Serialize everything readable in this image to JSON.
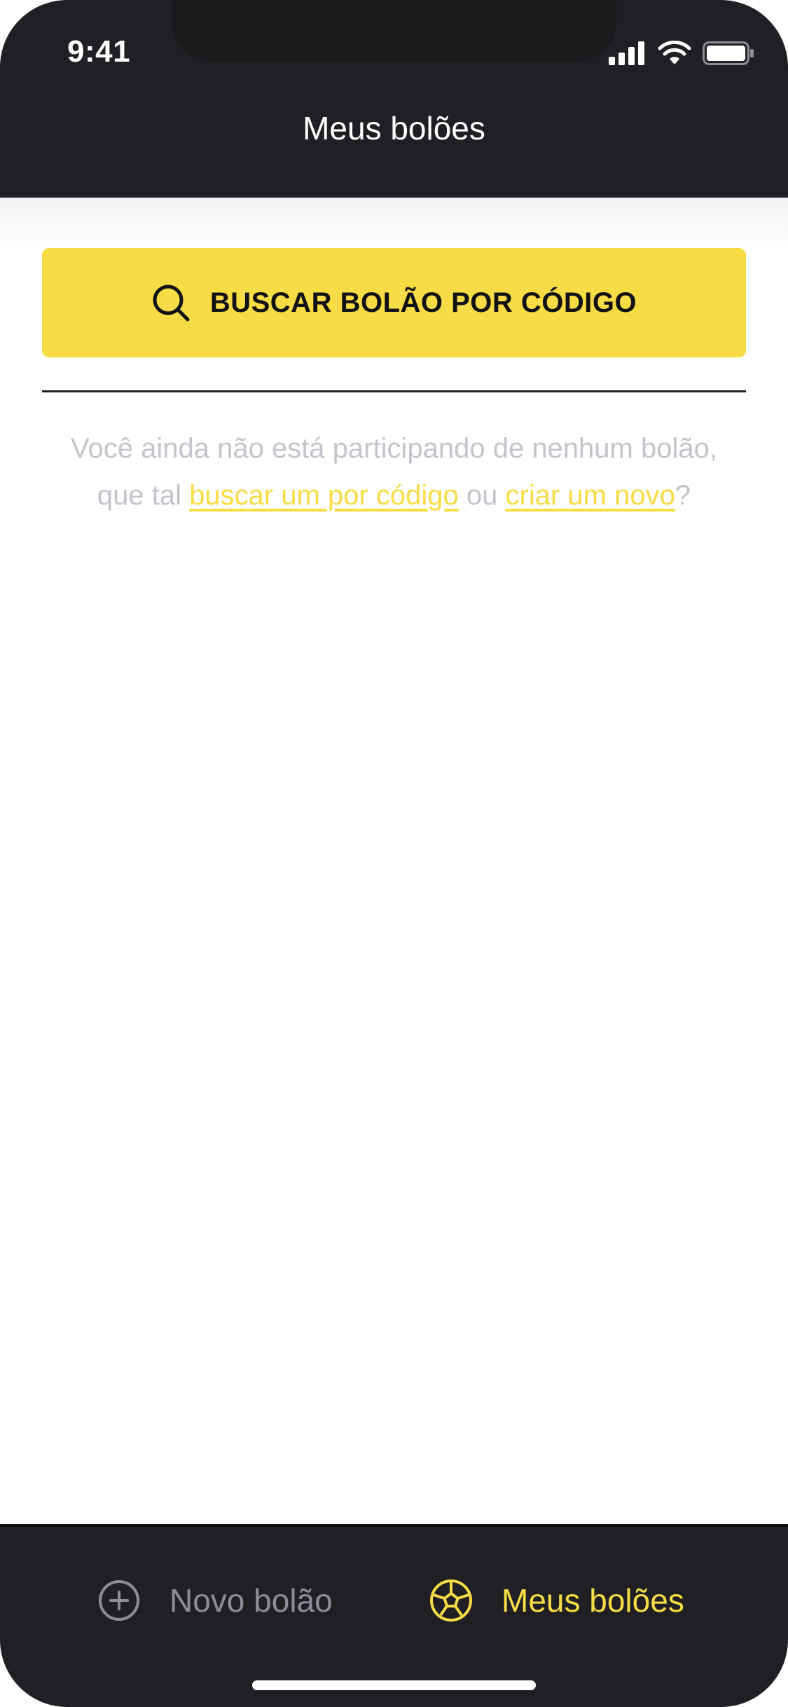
{
  "status_bar": {
    "time": "9:41",
    "signal_icon": "cellular-signal-icon",
    "wifi_icon": "wifi-icon",
    "battery_icon": "battery-icon"
  },
  "header": {
    "title": "Meus bolões"
  },
  "search_button": {
    "icon": "search-icon",
    "label": "BUSCAR BOLÃO POR CÓDIGO"
  },
  "empty_state": {
    "text_1": "Você ainda não está participando de nenhum bolão, que tal ",
    "link_search": "buscar um por código",
    "text_2": " ou ",
    "link_create": "criar um novo",
    "text_3": "?"
  },
  "tab_bar": {
    "tabs": [
      {
        "label": "Novo bolão",
        "icon": "plus-circle-icon",
        "active": false
      },
      {
        "label": "Meus bolões",
        "icon": "soccer-ball-icon",
        "active": true
      }
    ]
  },
  "colors": {
    "background_dark": "#202024",
    "accent_yellow": "#F7DC45",
    "text_muted": "#C4C4CC",
    "tab_inactive": "#8D8D99"
  }
}
